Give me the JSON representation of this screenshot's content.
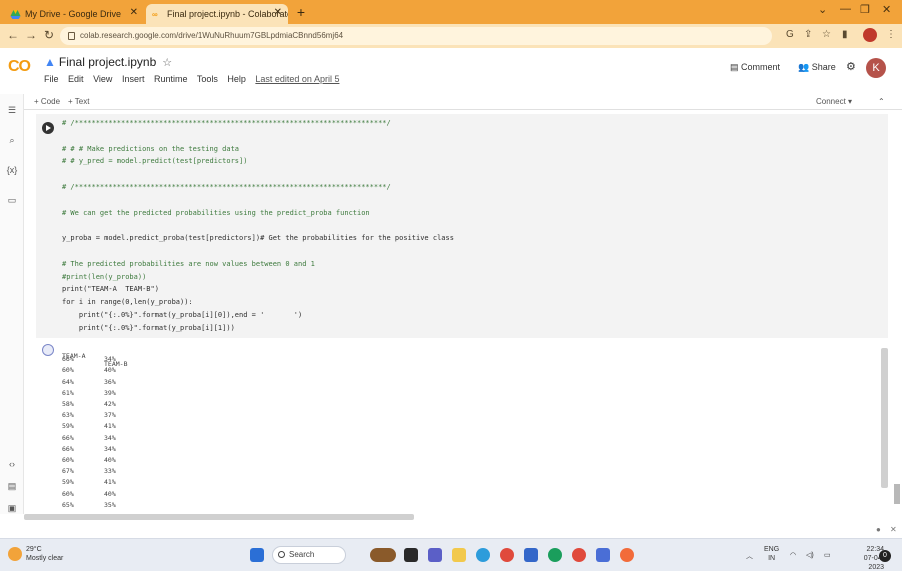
{
  "browser": {
    "tabs": [
      {
        "label": "My Drive - Google Drive",
        "icon": "google-drive-icon"
      },
      {
        "label": "Final project.ipynb - Colaboratory",
        "icon": "colab-icon"
      }
    ],
    "new_tab_label": "+",
    "url": "colab.research.google.com/drive/1WuNuRhuum7GBLpdmiaCBnnd56mj64",
    "colors": {
      "tabstrip": "#f2a33a",
      "addressbar": "#fbe3b8"
    }
  },
  "colab": {
    "logo_text": "CO",
    "notebook_title": "Final project.ipynb",
    "menu": [
      "File",
      "Edit",
      "View",
      "Insert",
      "Runtime",
      "Tools",
      "Help"
    ],
    "last_edited": "Last edited on April 5",
    "comment_label": "Comment",
    "share_label": "Share",
    "avatar_letter": "K"
  },
  "toolbar": {
    "code_label": "+ Code",
    "text_label": "+ Text",
    "connect_label": "Connect"
  },
  "cell": {
    "lines": [
      {
        "text": "# /**************************************************************************/",
        "kind": "comment"
      },
      {
        "text": "",
        "kind": "plain"
      },
      {
        "text": "# # # Make predictions on the testing data",
        "kind": "comment"
      },
      {
        "text": "# # y_pred = model.predict(test[predictors])",
        "kind": "comment"
      },
      {
        "text": "",
        "kind": "plain"
      },
      {
        "text": "# /**************************************************************************/",
        "kind": "comment"
      },
      {
        "text": "",
        "kind": "plain"
      },
      {
        "text": "# We can get the predicted probabilities using the predict_proba function",
        "kind": "comment"
      },
      {
        "text": "",
        "kind": "plain"
      },
      {
        "text": "y_proba = model.predict_proba(test[predictors])# Get the probabilities for the positive class",
        "kind": "plain"
      },
      {
        "text": "",
        "kind": "plain"
      },
      {
        "text": "# The predicted probabilities are now values between 0 and 1",
        "kind": "comment"
      },
      {
        "text": "#print(len(y_proba))",
        "kind": "comment"
      },
      {
        "text": "print(\"TEAM-A  TEAM-B\")",
        "kind": "plain"
      },
      {
        "text": "for i in range(0,len(y_proba)):",
        "kind": "plain"
      },
      {
        "text": "    print(\"{:.0%}\".format(y_proba[i][0]),end = '       ')",
        "kind": "plain"
      },
      {
        "text": "    print(\"{:.0%}\".format(y_proba[i][1]))",
        "kind": "plain"
      }
    ]
  },
  "output": {
    "header": [
      "TEAM-A",
      "TEAM-B"
    ],
    "rows": [
      [
        "66%",
        "34%"
      ],
      [
        "60%",
        "40%"
      ],
      [
        "64%",
        "36%"
      ],
      [
        "61%",
        "39%"
      ],
      [
        "58%",
        "42%"
      ],
      [
        "63%",
        "37%"
      ],
      [
        "59%",
        "41%"
      ],
      [
        "66%",
        "34%"
      ],
      [
        "66%",
        "34%"
      ],
      [
        "60%",
        "40%"
      ],
      [
        "67%",
        "33%"
      ],
      [
        "59%",
        "41%"
      ],
      [
        "60%",
        "40%"
      ],
      [
        "65%",
        "35%"
      ]
    ]
  },
  "taskbar": {
    "weather_temp": "29°C",
    "weather_desc": "Mostly clear",
    "search_label": "Search",
    "lang": "ENG",
    "lang_region": "IN",
    "time": "22:34",
    "date": "07-04-2023",
    "notifications": "0"
  }
}
